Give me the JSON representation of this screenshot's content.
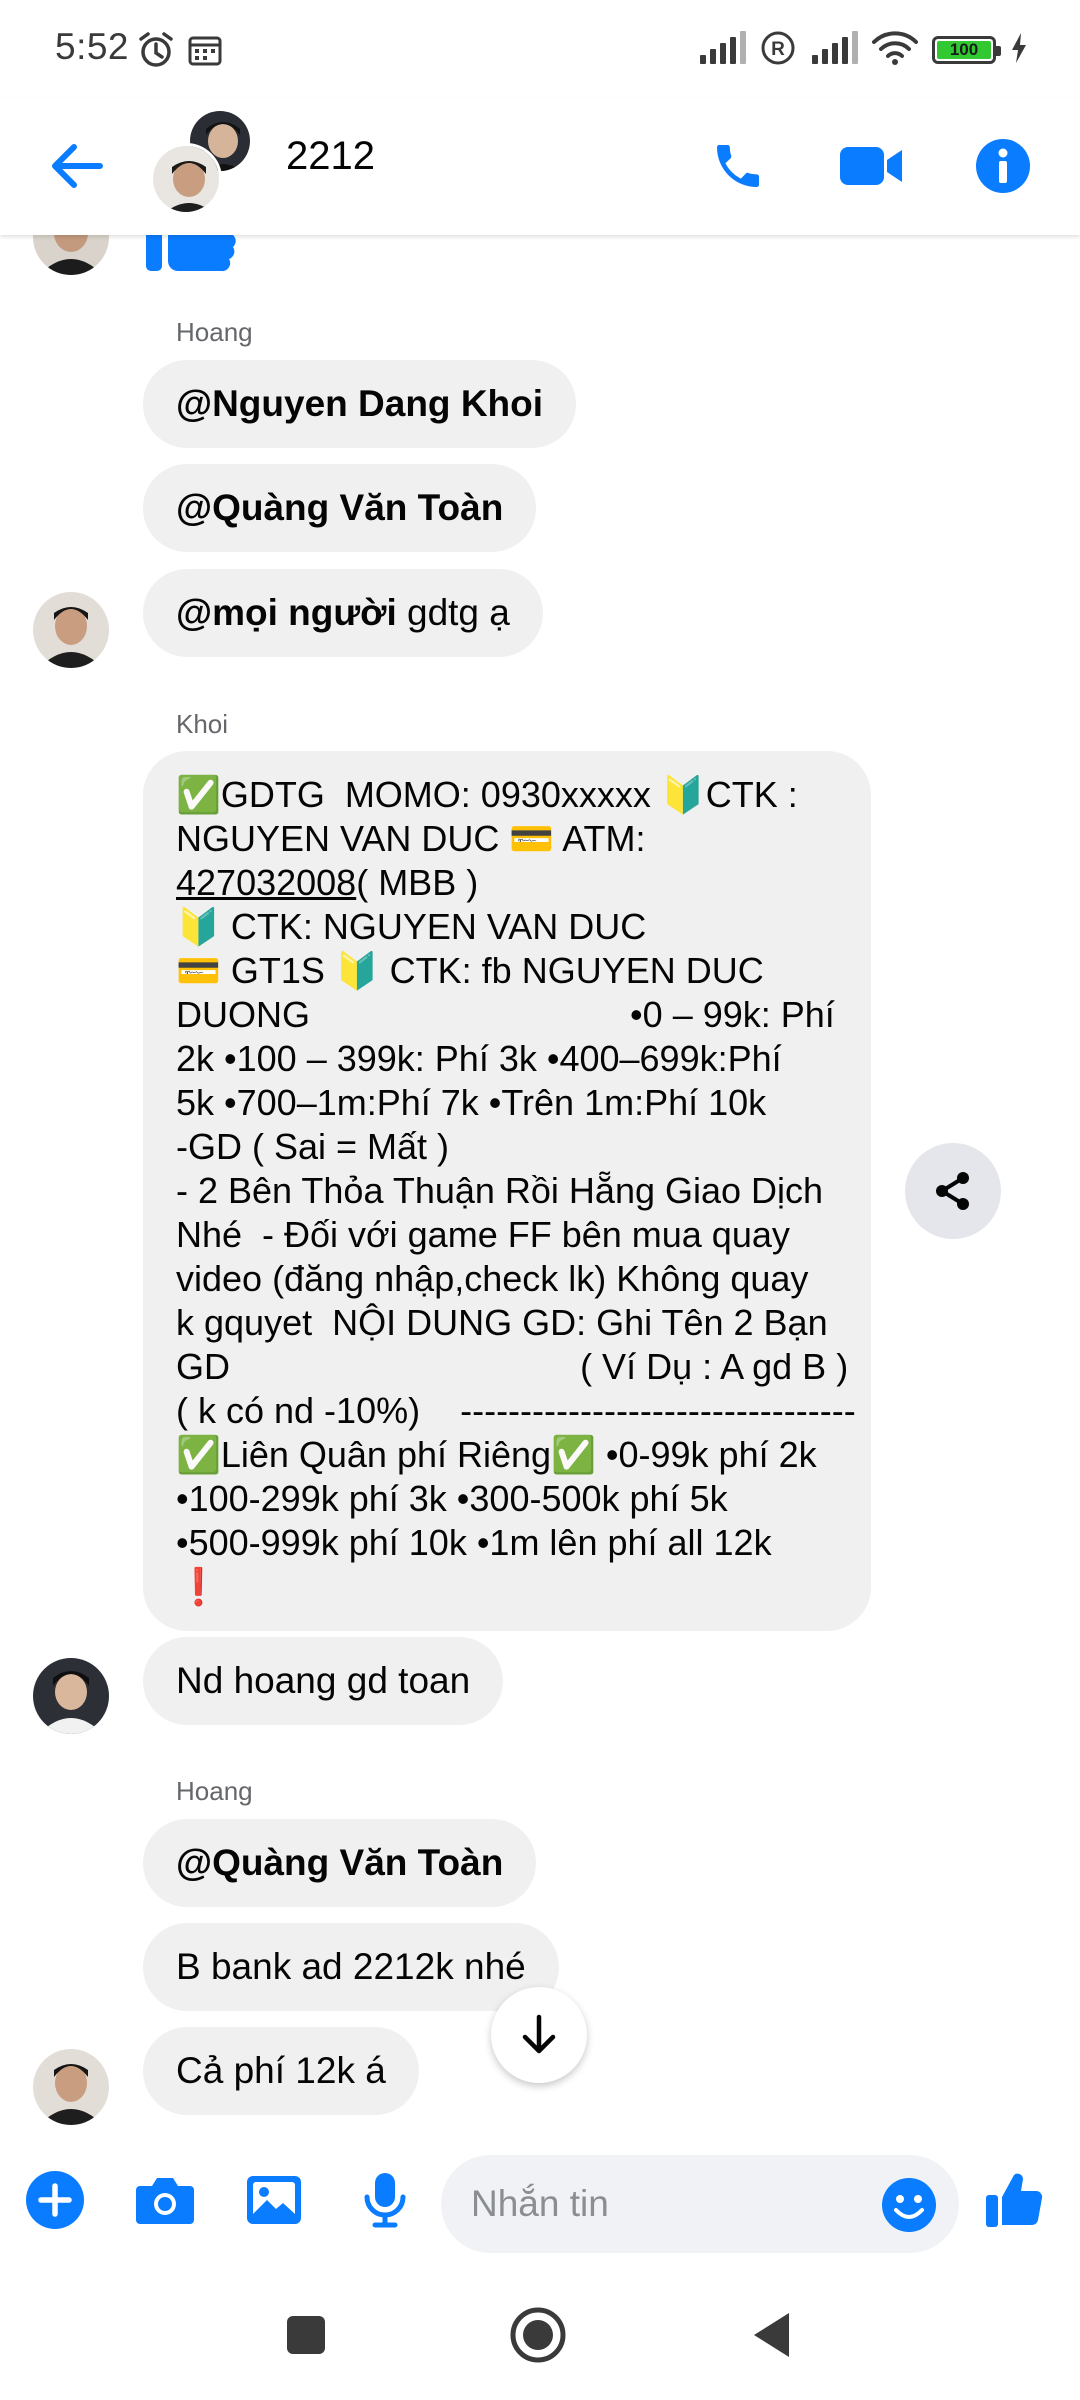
{
  "status": {
    "time": "5:52",
    "battery": "100"
  },
  "header": {
    "title": "2212"
  },
  "colors": {
    "accent": "#0a7cff",
    "bubble": "#f0f0f0",
    "sender": "#65676b"
  },
  "messages": {
    "m1": {
      "sender": "Hoang",
      "text": "@Nguyen Dang Khoi"
    },
    "m2": {
      "text": "@Quàng Văn Toàn"
    },
    "m3": {
      "mention": "@mọi người",
      "text": " gdtg ạ"
    },
    "m4": {
      "sender": "Khoi",
      "lines": [
        "✅GDTG  MOMO: 0930xxxxx 🔰CTK :",
        "NGUYEN VAN DUC 💳 ATM:",
        "( MBB )",
        "🔰 CTK: NGUYEN VAN DUC",
        "💳 GT1S 🔰 CTK: fb NGUYEN DUC",
        "DUONG                                •0 – 99k: Phí",
        "2k •100 – 399k: Phí 3k •400–699k:Phí",
        "5k •700–1m:Phí 7k •Trên 1m:Phí 10k",
        "-GD ( Sai = Mất )",
        "- 2 Bên Thỏa Thuận Rồi Hẵng Giao Dịch",
        "Nhé  - Đối với game FF bên mua quay",
        "video (đăng nhập,check lk) Không quay",
        "k gquyet  NỘI DUNG GD: Ghi Tên 2 Bạn",
        "GD                                   ( Ví Dụ : A gd B )",
        "( k có nd -10%)    ---------------------------------",
        "✅Liên Quân phí Riêng✅ •0-99k phí 2k",
        "•100-299k phí 3k •300-500k phí 5k",
        "•500-999k phí 10k •1m lên phí all 12k",
        "❗"
      ],
      "account_link": "427032008"
    },
    "m5": {
      "text": "Nd hoang gd toan"
    },
    "m6": {
      "sender": "Hoang",
      "text": "@Quàng Văn Toàn"
    },
    "m7": {
      "text": "B bank ad 2212k nhé"
    },
    "m8": {
      "text": "Cả phí 12k á"
    }
  },
  "composer": {
    "placeholder": "Nhắn tin"
  }
}
